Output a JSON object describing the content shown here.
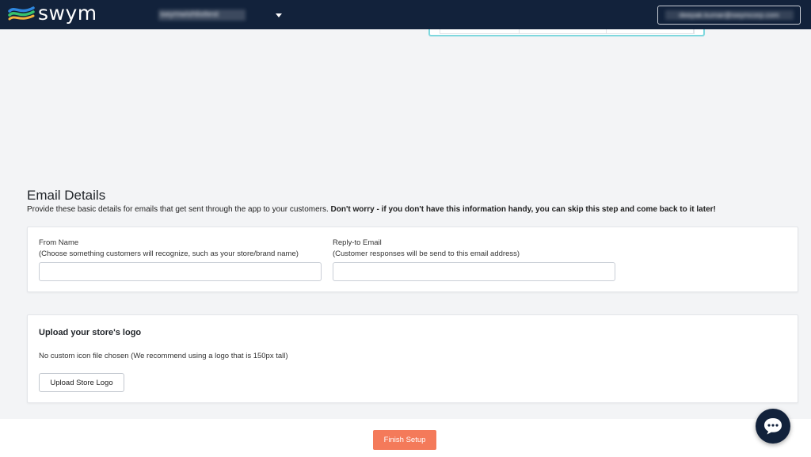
{
  "header": {
    "logo_text": "swym",
    "store_name": "swymwishlisttest",
    "account_email": "deepak.kumar@swymcorp.com",
    "colors": {
      "background": "#12223b",
      "logo_blue": "#2e86de",
      "logo_green": "#36c26c",
      "logo_yellow": "#f2b33d"
    },
    "icons": {
      "store_dropdown": "caret-down-icon"
    }
  },
  "email_details": {
    "title": "Email Details",
    "description_plain": "Provide these basic details for emails that get sent through the app to your customers.",
    "description_bold": "Don't worry - if you don't have this information handy, you can skip this step and come back to it later!",
    "from_name": {
      "label": "From Name",
      "hint": "(Choose something customers will recognize, such as your store/brand name)",
      "value": ""
    },
    "reply_to": {
      "label": "Reply-to Email",
      "hint": "(Customer responses will be send to this email address)",
      "value": ""
    }
  },
  "logo_upload": {
    "title": "Upload your store's logo",
    "note": "No custom icon file chosen (We recommend using a logo that is 150px tall)",
    "button_label": "Upload Store Logo"
  },
  "footer": {
    "finish_label": "Finish Setup",
    "finish_color": "#f47a5a"
  },
  "chat": {
    "icon": "chat-bubble-icon"
  }
}
